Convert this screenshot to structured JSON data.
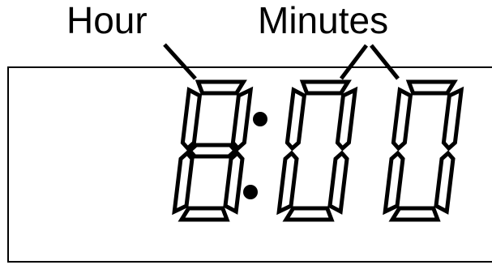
{
  "labels": {
    "hour": "Hour",
    "minutes": "Minutes"
  },
  "display": {
    "time": "8:00",
    "digits": [
      "8",
      "0",
      "0"
    ],
    "has_colon": true,
    "segment_color": "#000000",
    "background_color": "#ffffff"
  }
}
